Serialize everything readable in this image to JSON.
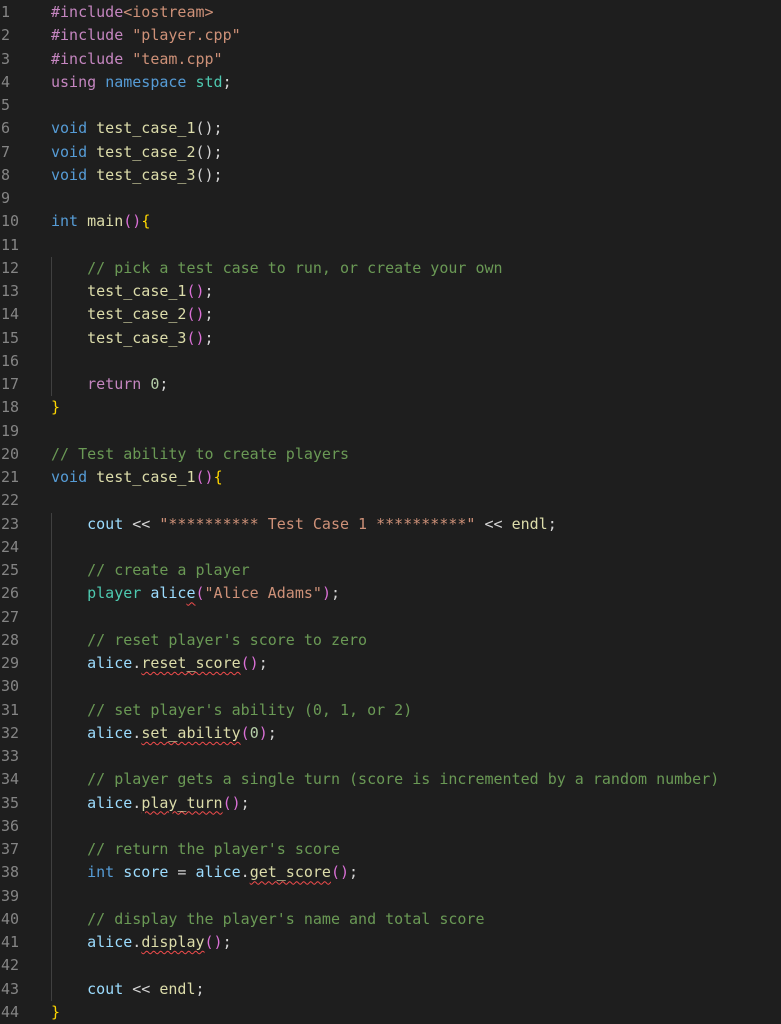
{
  "editor": {
    "lines": [
      {
        "n": "1",
        "tokens": [
          {
            "t": "#include",
            "c": "directive"
          },
          {
            "t": "<iostream>",
            "c": "string"
          }
        ]
      },
      {
        "n": "2",
        "tokens": [
          {
            "t": "#include",
            "c": "directive"
          },
          {
            "t": " ",
            "c": "plain"
          },
          {
            "t": "\"player.cpp\"",
            "c": "string"
          }
        ]
      },
      {
        "n": "3",
        "tokens": [
          {
            "t": "#include",
            "c": "directive"
          },
          {
            "t": " ",
            "c": "plain"
          },
          {
            "t": "\"team.cpp\"",
            "c": "string"
          }
        ]
      },
      {
        "n": "4",
        "tokens": [
          {
            "t": "using",
            "c": "directive"
          },
          {
            "t": " ",
            "c": "plain"
          },
          {
            "t": "namespace",
            "c": "keyword"
          },
          {
            "t": " ",
            "c": "plain"
          },
          {
            "t": "std",
            "c": "type"
          },
          {
            "t": ";",
            "c": "plain"
          }
        ]
      },
      {
        "n": "5",
        "tokens": []
      },
      {
        "n": "6",
        "tokens": [
          {
            "t": "void",
            "c": "keyword"
          },
          {
            "t": " ",
            "c": "plain"
          },
          {
            "t": "test_case_1",
            "c": "func"
          },
          {
            "t": "();",
            "c": "plain"
          }
        ]
      },
      {
        "n": "7",
        "tokens": [
          {
            "t": "void",
            "c": "keyword"
          },
          {
            "t": " ",
            "c": "plain"
          },
          {
            "t": "test_case_2",
            "c": "func"
          },
          {
            "t": "();",
            "c": "plain"
          }
        ]
      },
      {
        "n": "8",
        "tokens": [
          {
            "t": "void",
            "c": "keyword"
          },
          {
            "t": " ",
            "c": "plain"
          },
          {
            "t": "test_case_3",
            "c": "func"
          },
          {
            "t": "();",
            "c": "plain"
          }
        ]
      },
      {
        "n": "9",
        "tokens": []
      },
      {
        "n": "10",
        "tokens": [
          {
            "t": "int",
            "c": "keyword"
          },
          {
            "t": " ",
            "c": "plain"
          },
          {
            "t": "main",
            "c": "func"
          },
          {
            "t": "()",
            "c": "paren"
          },
          {
            "t": "{",
            "c": "brace"
          }
        ]
      },
      {
        "n": "11",
        "tokens": []
      },
      {
        "n": "12",
        "tokens": [
          {
            "t": "    ",
            "c": "plain"
          },
          {
            "t": "// pick a test case to run, or create your own",
            "c": "comment"
          }
        ]
      },
      {
        "n": "13",
        "tokens": [
          {
            "t": "    ",
            "c": "plain"
          },
          {
            "t": "test_case_1",
            "c": "func"
          },
          {
            "t": "()",
            "c": "paren"
          },
          {
            "t": ";",
            "c": "plain"
          }
        ]
      },
      {
        "n": "14",
        "tokens": [
          {
            "t": "    ",
            "c": "plain"
          },
          {
            "t": "test_case_2",
            "c": "func"
          },
          {
            "t": "()",
            "c": "paren"
          },
          {
            "t": ";",
            "c": "plain"
          }
        ]
      },
      {
        "n": "15",
        "tokens": [
          {
            "t": "    ",
            "c": "plain"
          },
          {
            "t": "test_case_3",
            "c": "func"
          },
          {
            "t": "()",
            "c": "paren"
          },
          {
            "t": ";",
            "c": "plain"
          }
        ]
      },
      {
        "n": "16",
        "tokens": []
      },
      {
        "n": "17",
        "tokens": [
          {
            "t": "    ",
            "c": "plain"
          },
          {
            "t": "return",
            "c": "directive"
          },
          {
            "t": " ",
            "c": "plain"
          },
          {
            "t": "0",
            "c": "num"
          },
          {
            "t": ";",
            "c": "plain"
          }
        ]
      },
      {
        "n": "18",
        "tokens": [
          {
            "t": "}",
            "c": "brace"
          }
        ]
      },
      {
        "n": "19",
        "tokens": []
      },
      {
        "n": "20",
        "tokens": [
          {
            "t": "// Test ability to create players",
            "c": "comment"
          }
        ]
      },
      {
        "n": "21",
        "tokens": [
          {
            "t": "void",
            "c": "keyword"
          },
          {
            "t": " ",
            "c": "plain"
          },
          {
            "t": "test_case_1",
            "c": "func"
          },
          {
            "t": "()",
            "c": "paren"
          },
          {
            "t": "{",
            "c": "brace"
          }
        ]
      },
      {
        "n": "22",
        "tokens": []
      },
      {
        "n": "23",
        "tokens": [
          {
            "t": "    ",
            "c": "plain"
          },
          {
            "t": "cout",
            "c": "var"
          },
          {
            "t": " << ",
            "c": "plain"
          },
          {
            "t": "\"********** Test Case 1 **********\"",
            "c": "string"
          },
          {
            "t": " << ",
            "c": "plain"
          },
          {
            "t": "endl",
            "c": "func"
          },
          {
            "t": ";",
            "c": "plain"
          }
        ]
      },
      {
        "n": "24",
        "tokens": []
      },
      {
        "n": "25",
        "tokens": [
          {
            "t": "    ",
            "c": "plain"
          },
          {
            "t": "// create a player",
            "c": "comment"
          }
        ]
      },
      {
        "n": "26",
        "tokens": [
          {
            "t": "    ",
            "c": "plain"
          },
          {
            "t": "player",
            "c": "type"
          },
          {
            "t": " ",
            "c": "plain"
          },
          {
            "t": "alic",
            "c": "var"
          },
          {
            "t": "e",
            "c": "var",
            "sq": true
          },
          {
            "t": "(",
            "c": "paren"
          },
          {
            "t": "\"Alice Adams\"",
            "c": "string"
          },
          {
            "t": ")",
            "c": "paren"
          },
          {
            "t": ";",
            "c": "plain"
          }
        ]
      },
      {
        "n": "27",
        "tokens": []
      },
      {
        "n": "28",
        "tokens": [
          {
            "t": "    ",
            "c": "plain"
          },
          {
            "t": "// reset player's score to zero",
            "c": "comment"
          }
        ]
      },
      {
        "n": "29",
        "tokens": [
          {
            "t": "    ",
            "c": "plain"
          },
          {
            "t": "alice",
            "c": "var"
          },
          {
            "t": ".",
            "c": "plain"
          },
          {
            "t": "reset_score",
            "c": "func",
            "sq": true
          },
          {
            "t": "()",
            "c": "paren"
          },
          {
            "t": ";",
            "c": "plain"
          }
        ]
      },
      {
        "n": "30",
        "tokens": []
      },
      {
        "n": "31",
        "tokens": [
          {
            "t": "    ",
            "c": "plain"
          },
          {
            "t": "// set player's ability (0, 1, or 2)",
            "c": "comment"
          }
        ]
      },
      {
        "n": "32",
        "tokens": [
          {
            "t": "    ",
            "c": "plain"
          },
          {
            "t": "alice",
            "c": "var"
          },
          {
            "t": ".",
            "c": "plain"
          },
          {
            "t": "set_ability",
            "c": "func",
            "sq": true
          },
          {
            "t": "(",
            "c": "paren"
          },
          {
            "t": "0",
            "c": "num"
          },
          {
            "t": ")",
            "c": "paren"
          },
          {
            "t": ";",
            "c": "plain"
          }
        ]
      },
      {
        "n": "33",
        "tokens": []
      },
      {
        "n": "34",
        "tokens": [
          {
            "t": "    ",
            "c": "plain"
          },
          {
            "t": "// player gets a single turn (score is incremented by a random number)",
            "c": "comment"
          }
        ]
      },
      {
        "n": "35",
        "tokens": [
          {
            "t": "    ",
            "c": "plain"
          },
          {
            "t": "alice",
            "c": "var"
          },
          {
            "t": ".",
            "c": "plain"
          },
          {
            "t": "play_turn",
            "c": "func",
            "sq": true
          },
          {
            "t": "()",
            "c": "paren"
          },
          {
            "t": ";",
            "c": "plain"
          }
        ]
      },
      {
        "n": "36",
        "tokens": []
      },
      {
        "n": "37",
        "tokens": [
          {
            "t": "    ",
            "c": "plain"
          },
          {
            "t": "// return the player's score",
            "c": "comment"
          }
        ]
      },
      {
        "n": "38",
        "tokens": [
          {
            "t": "    ",
            "c": "plain"
          },
          {
            "t": "int",
            "c": "keyword"
          },
          {
            "t": " ",
            "c": "plain"
          },
          {
            "t": "score",
            "c": "var"
          },
          {
            "t": " = ",
            "c": "plain"
          },
          {
            "t": "alice",
            "c": "var"
          },
          {
            "t": ".",
            "c": "plain"
          },
          {
            "t": "get_score",
            "c": "func",
            "sq": true
          },
          {
            "t": "()",
            "c": "paren"
          },
          {
            "t": ";",
            "c": "plain"
          }
        ]
      },
      {
        "n": "39",
        "tokens": []
      },
      {
        "n": "40",
        "tokens": [
          {
            "t": "    ",
            "c": "plain"
          },
          {
            "t": "// display the player's name and total score",
            "c": "comment"
          }
        ]
      },
      {
        "n": "41",
        "tokens": [
          {
            "t": "    ",
            "c": "plain"
          },
          {
            "t": "alice",
            "c": "var"
          },
          {
            "t": ".",
            "c": "plain"
          },
          {
            "t": "display",
            "c": "func",
            "sq": true
          },
          {
            "t": "()",
            "c": "paren"
          },
          {
            "t": ";",
            "c": "plain"
          }
        ]
      },
      {
        "n": "42",
        "tokens": []
      },
      {
        "n": "43",
        "tokens": [
          {
            "t": "    ",
            "c": "plain"
          },
          {
            "t": "cout",
            "c": "var"
          },
          {
            "t": " << ",
            "c": "plain"
          },
          {
            "t": "endl",
            "c": "func"
          },
          {
            "t": ";",
            "c": "plain"
          }
        ]
      },
      {
        "n": "44",
        "tokens": [
          {
            "t": "}",
            "c": "brace"
          }
        ]
      }
    ]
  }
}
